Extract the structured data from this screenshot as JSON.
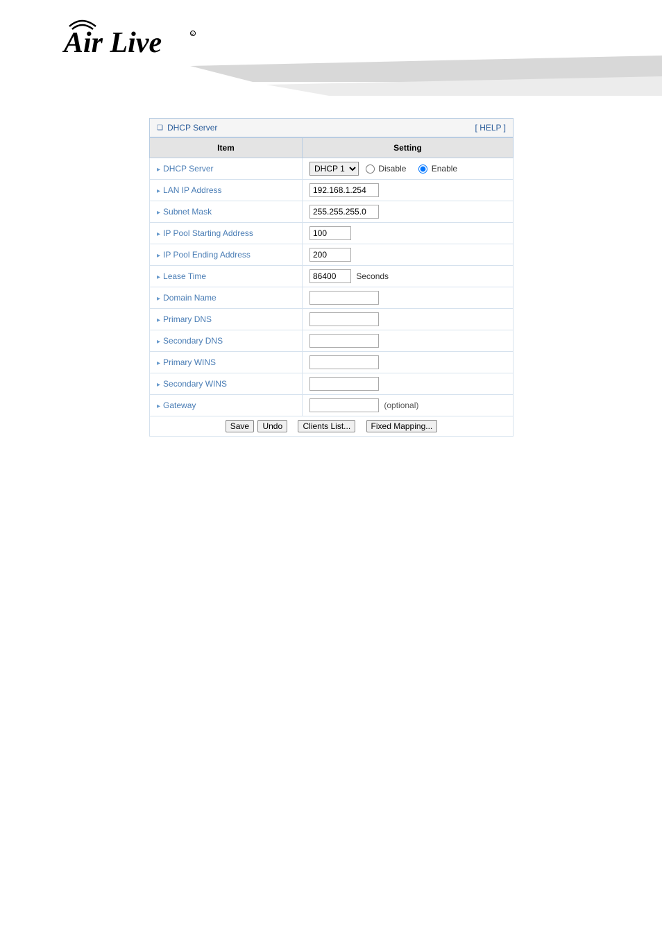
{
  "logo": {
    "brand": "Air Live"
  },
  "panel": {
    "title": "DHCP Server",
    "help": "[ HELP ]"
  },
  "headers": {
    "item": "Item",
    "setting": "Setting"
  },
  "rows": {
    "dhcp_server": {
      "label": "DHCP Server",
      "select_value": "DHCP 1",
      "disable": "Disable",
      "enable": "Enable",
      "selected": "enable"
    },
    "lan_ip": {
      "label": "LAN IP Address",
      "value": "192.168.1.254"
    },
    "subnet": {
      "label": "Subnet Mask",
      "value": "255.255.255.0"
    },
    "pool_start": {
      "label": "IP Pool Starting Address",
      "value": "100"
    },
    "pool_end": {
      "label": "IP Pool Ending Address",
      "value": "200"
    },
    "lease": {
      "label": "Lease Time",
      "value": "86400",
      "unit": "Seconds"
    },
    "domain": {
      "label": "Domain Name",
      "value": ""
    },
    "pdns": {
      "label": "Primary DNS",
      "value": ""
    },
    "sdns": {
      "label": "Secondary DNS",
      "value": ""
    },
    "pwins": {
      "label": "Primary WINS",
      "value": ""
    },
    "swins": {
      "label": "Secondary WINS",
      "value": ""
    },
    "gateway": {
      "label": "Gateway",
      "value": "",
      "optional": "(optional)"
    }
  },
  "buttons": {
    "save": "Save",
    "undo": "Undo",
    "clients": "Clients List...",
    "fixed": "Fixed Mapping..."
  }
}
